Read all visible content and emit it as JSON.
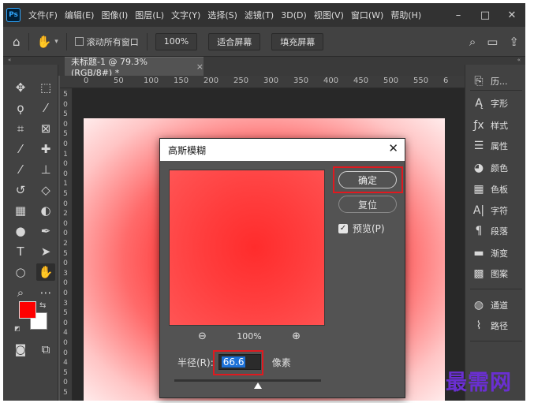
{
  "app": {
    "logo": "Ps"
  },
  "menu": [
    "文件(F)",
    "编辑(E)",
    "图像(I)",
    "图层(L)",
    "文字(Y)",
    "选择(S)",
    "滤镜(T)",
    "3D(D)",
    "视图(V)",
    "窗口(W)",
    "帮助(H)"
  ],
  "window_controls": {
    "minimize": "–",
    "restore": "□",
    "close": "✕"
  },
  "options_bar": {
    "scroll_all_label": "滚动所有窗口",
    "zoom_value": "100%",
    "fit_screen": "适合屏幕",
    "fill_screen": "填充屏幕"
  },
  "document": {
    "tab_title": "未标题-1 @ 79.3%(RGB/8#) *",
    "close": "×"
  },
  "ruler": {
    "h": [
      "0",
      "50",
      "100",
      "150",
      "200",
      "250",
      "300",
      "350",
      "400",
      "450",
      "500",
      "550",
      "6"
    ],
    "v": [
      "5",
      "0",
      "5",
      "0",
      "5",
      "0",
      "1",
      "0",
      "0",
      "1",
      "5",
      "0",
      "2",
      "0",
      "0",
      "2",
      "5",
      "0",
      "3",
      "0",
      "0",
      "3",
      "5",
      "0",
      "4",
      "0",
      "0",
      "4",
      "5",
      "0",
      "5"
    ]
  },
  "panels": {
    "items": [
      {
        "icon": "history-icon",
        "label": "历..."
      },
      {
        "icon": "character-icon",
        "label": "字形"
      },
      {
        "icon": "styles-icon",
        "label": "样式"
      },
      {
        "icon": "properties-icon",
        "label": "属性"
      },
      {
        "icon": "color-icon",
        "label": "颜色"
      },
      {
        "icon": "swatches-icon",
        "label": "色板"
      },
      {
        "icon": "type-icon",
        "label": "字符"
      },
      {
        "icon": "paragraph-icon",
        "label": "段落"
      },
      {
        "icon": "gradient-icon",
        "label": "渐变"
      },
      {
        "icon": "patterns-icon",
        "label": "图案"
      },
      {
        "icon": "channels-icon",
        "label": "通道"
      },
      {
        "icon": "paths-icon",
        "label": "路径"
      }
    ]
  },
  "dialog": {
    "title": "高斯模糊",
    "close": "✕",
    "ok_label": "确定",
    "reset_label": "复位",
    "preview_label": "预览(P)",
    "preview_checked": true,
    "zoom_value": "100%",
    "radius_label": "半径(R):",
    "radius_value": "66.6",
    "radius_unit": "像素"
  },
  "colors": {
    "foreground": "#ff0000",
    "background": "#ffffff",
    "highlight": "#e0191f",
    "watermark": "#6a2fd1"
  },
  "watermark": "最需网"
}
